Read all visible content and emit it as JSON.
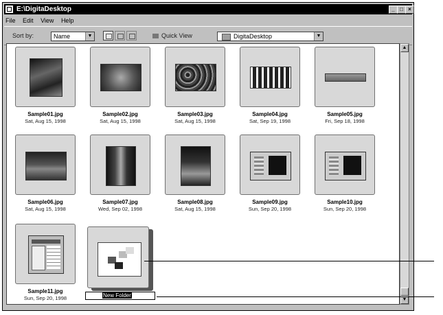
{
  "window": {
    "title": "E:\\DigitaDesktop"
  },
  "menu": [
    "File",
    "Edit",
    "View",
    "Help"
  ],
  "toolbar": {
    "sort_label": "Sort by:",
    "sort_value": "Name",
    "quick_view": "Quick View",
    "folder": "DigitaDesktop"
  },
  "files": [
    {
      "name": "Sample01.jpg",
      "date": "Sat, Aug 15, 1998"
    },
    {
      "name": "Sample02.jpg",
      "date": "Sat, Aug 15, 1998"
    },
    {
      "name": "Sample03.jpg",
      "date": "Sat, Aug 15, 1998"
    },
    {
      "name": "Sample04.jpg",
      "date": "Sat, Sep 19, 1998"
    },
    {
      "name": "Sample05.jpg",
      "date": "Fri, Sep 18, 1998"
    },
    {
      "name": "Sample06.jpg",
      "date": "Sat, Aug 15, 1998"
    },
    {
      "name": "Sample07.jpg",
      "date": "Wed, Sep 02, 1998"
    },
    {
      "name": "Sample08.jpg",
      "date": "Sat, Aug 15, 1998"
    },
    {
      "name": "Sample09.jpg",
      "date": "Sun, Sep 20, 1998"
    },
    {
      "name": "Sample10.jpg",
      "date": "Sun, Sep 20, 1998"
    },
    {
      "name": "Sample11.jpg",
      "date": "Sun, Sep 20, 1998"
    }
  ],
  "new_folder": {
    "label": "New Folder"
  }
}
